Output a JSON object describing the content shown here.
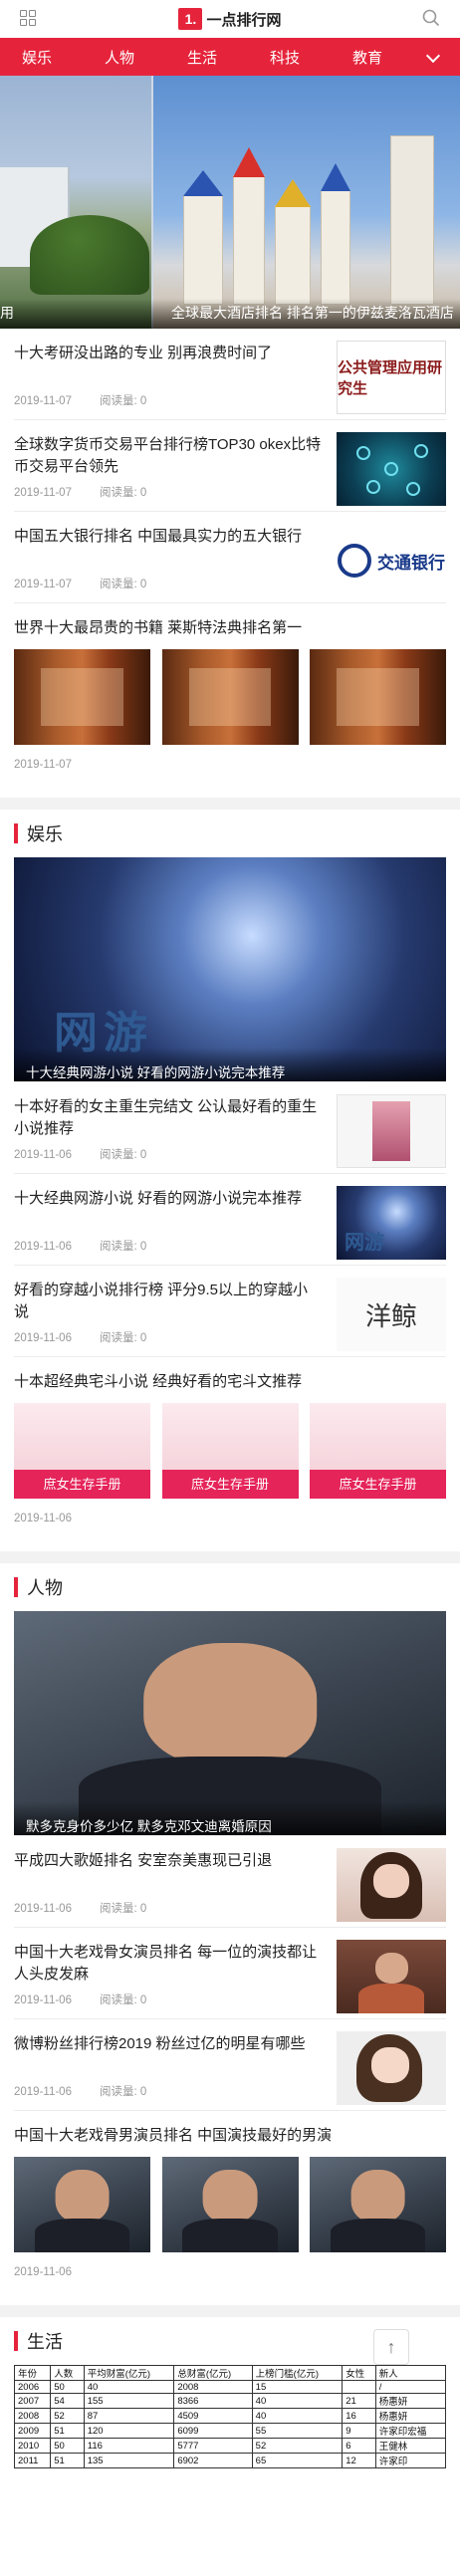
{
  "header": {
    "logo_mark": "1.",
    "logo_text": "一点排行网"
  },
  "nav": {
    "items": [
      "娱乐",
      "人物",
      "生活",
      "科技",
      "教育"
    ]
  },
  "hero": {
    "caption_left": "用",
    "caption_right": "全球最大酒店排名 排名第一的伊兹麦洛瓦酒店"
  },
  "top_list": [
    {
      "title": "十大考研没出路的专业 别再浪费时间了",
      "date": "2019-11-07",
      "views": "阅读量: 0",
      "thumb_text": "公共管理应用研究生"
    },
    {
      "title": "全球数字货币交易平台排行榜TOP30 okex比特币交易平台领先",
      "date": "2019-11-07",
      "views": "阅读量: 0"
    },
    {
      "title": "中国五大银行排名 中国最具实力的五大银行",
      "date": "2019-11-07",
      "views": "阅读量: 0",
      "thumb_text": "交通银行"
    },
    {
      "title": "世界十大最昂贵的书籍 莱斯特法典排名第一",
      "date": "2019-11-07"
    }
  ],
  "ent": {
    "name": "娱乐",
    "big_caption": "十大经典网游小说 好看的网游小说完本推荐",
    "big_text": "网游",
    "list": [
      {
        "title": "十本好看的女主重生完结文 公认最好看的重生小说推荐",
        "date": "2019-11-06",
        "views": "阅读量: 0"
      },
      {
        "title": "十大经典网游小说 好看的网游小说完本推荐",
        "date": "2019-11-06",
        "views": "阅读量: 0",
        "thumb_text": "网游"
      },
      {
        "title": "好看的穿越小说排行榜 评分9.5以上的穿越小说",
        "date": "2019-11-06",
        "views": "阅读量: 0",
        "thumb_text": "洋鲸"
      }
    ],
    "three": {
      "title": "十本超经典宅斗小说 经典好看的宅斗文推荐",
      "date": "2019-11-06",
      "pic_text": "庶女生存手册"
    }
  },
  "people": {
    "name": "人物",
    "big_caption": "默多克身价多少亿 默多克邓文迪离婚原因",
    "list": [
      {
        "title": "平成四大歌姬排名 安室奈美惠现已引退",
        "date": "2019-11-06",
        "views": "阅读量: 0"
      },
      {
        "title": "中国十大老戏骨女演员排名 每一位的演技都让人头皮发麻",
        "date": "2019-11-06",
        "views": "阅读量: 0"
      },
      {
        "title": "微博粉丝排行榜2019 粉丝过亿的明星有哪些",
        "date": "2019-11-06",
        "views": "阅读量: 0"
      }
    ],
    "three": {
      "title": "中国十大老戏骨男演员排名 中国演技最好的男演",
      "date": "2019-11-06"
    }
  },
  "life": {
    "name": "生活",
    "table_header": [
      "年份",
      "人数",
      "平均财富(亿元)",
      "总财富(亿元)",
      "上榜门槛(亿元)",
      "女性",
      "新人"
    ],
    "table_rows": [
      [
        "2006",
        "50",
        "40",
        "2008",
        "15",
        "",
        "/"
      ],
      [
        "2007",
        "54",
        "155",
        "8366",
        "40",
        "21",
        "杨惠妍"
      ],
      [
        "2008",
        "52",
        "87",
        "4509",
        "40",
        "16",
        "杨惠妍"
      ],
      [
        "2009",
        "51",
        "120",
        "6099",
        "55",
        "9",
        "许家印宏福"
      ],
      [
        "2010",
        "50",
        "116",
        "5777",
        "52",
        "6",
        "王健林"
      ],
      [
        "2011",
        "51",
        "135",
        "6902",
        "65",
        "12",
        "许家印"
      ]
    ]
  },
  "back_to_top": "↑"
}
